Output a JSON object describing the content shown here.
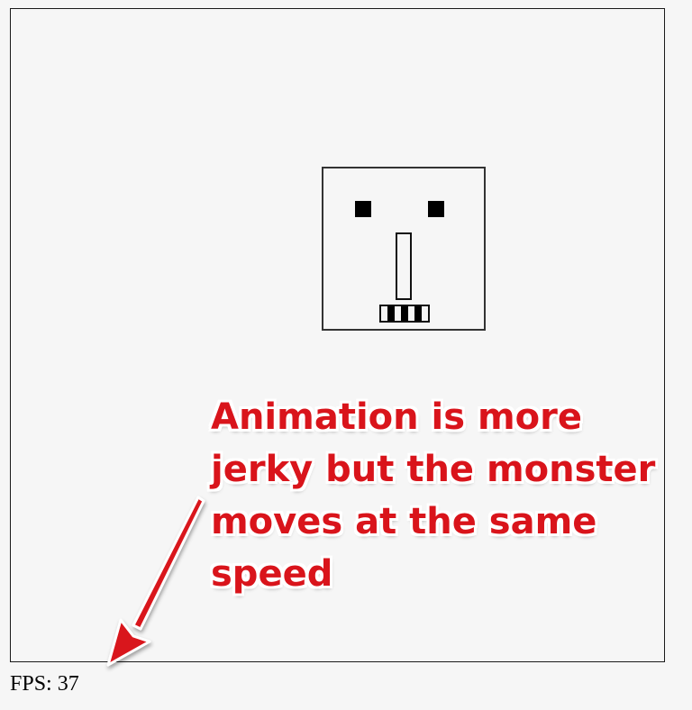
{
  "annotation": {
    "lines": [
      "Animation is more",
      "jerky but the monster",
      "moves at the same",
      "speed"
    ],
    "color": "#d9141b"
  },
  "status": {
    "fps_label": "FPS:",
    "fps_value": "37"
  },
  "colors": {
    "background": "#f6f6f6",
    "monster_outline": "#333333",
    "annotation_red": "#d9141b"
  }
}
